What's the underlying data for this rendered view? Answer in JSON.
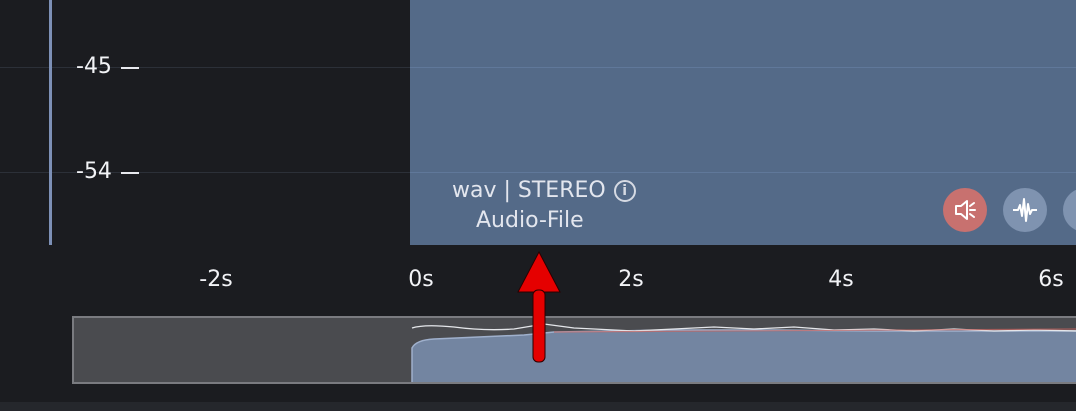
{
  "track": {
    "db_labels": [
      "-45",
      "-54"
    ],
    "clip": {
      "format_line": "wav | STEREO",
      "info_icon_glyph": "i",
      "type_label": "Audio-File"
    },
    "buttons": [
      {
        "name": "mute",
        "icon": "speaker-muted-icon",
        "color": "#c8716f"
      },
      {
        "name": "waveform",
        "icon": "waveform-icon",
        "color": "#7f93b0"
      },
      {
        "name": "download",
        "icon": "download-icon",
        "color": "#7f93b0"
      }
    ]
  },
  "timeline": {
    "labels": [
      "-2s",
      "0s",
      "2s",
      "4s",
      "6s"
    ]
  },
  "colors": {
    "background": "#1b1c20",
    "clip": "#546a88",
    "accent_left_rule": "#7d90b6",
    "mute_button": "#c8716f",
    "arrow": "#e50000"
  }
}
